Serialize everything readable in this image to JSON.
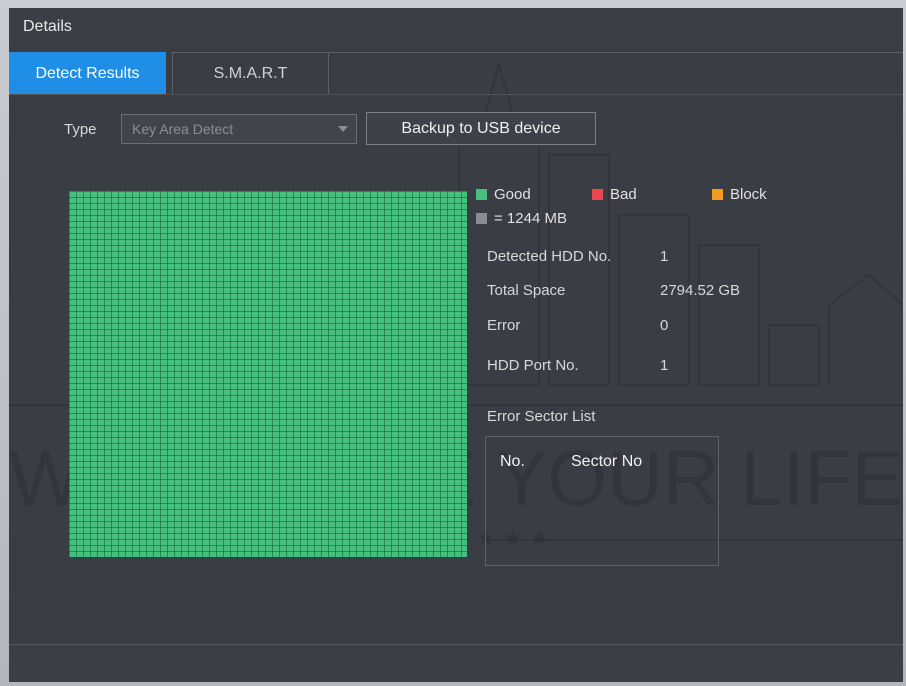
{
  "window": {
    "title": "Details"
  },
  "tabs": [
    {
      "label": "Detect Results",
      "active": true
    },
    {
      "label": "S.M.A.R.T",
      "active": false
    }
  ],
  "type_filter": {
    "label": "Type",
    "selected": "Key Area Detect"
  },
  "backup_button": {
    "label": "Backup to USB device"
  },
  "legend": {
    "good": {
      "label": "Good",
      "color": "#44c17c"
    },
    "bad": {
      "label": "Bad",
      "color": "#e8474f"
    },
    "block": {
      "label": "Block",
      "color": "#f29b1e"
    },
    "unit": {
      "label": "= 1244 MB",
      "color": "#8a8d93"
    }
  },
  "info": {
    "detected_hdd": {
      "label": "Detected HDD No.",
      "value": "1"
    },
    "total_space": {
      "label": "Total Space",
      "value": "2794.52 GB"
    },
    "error": {
      "label": "Error",
      "value": "0"
    },
    "hdd_port": {
      "label": "HDD Port No.",
      "value": "1"
    }
  },
  "error_sector_list": {
    "title": "Error Sector List",
    "columns": [
      "No.",
      "Sector No"
    ]
  },
  "watermark": {
    "text": "WE SECURE YOUR LIFE"
  }
}
